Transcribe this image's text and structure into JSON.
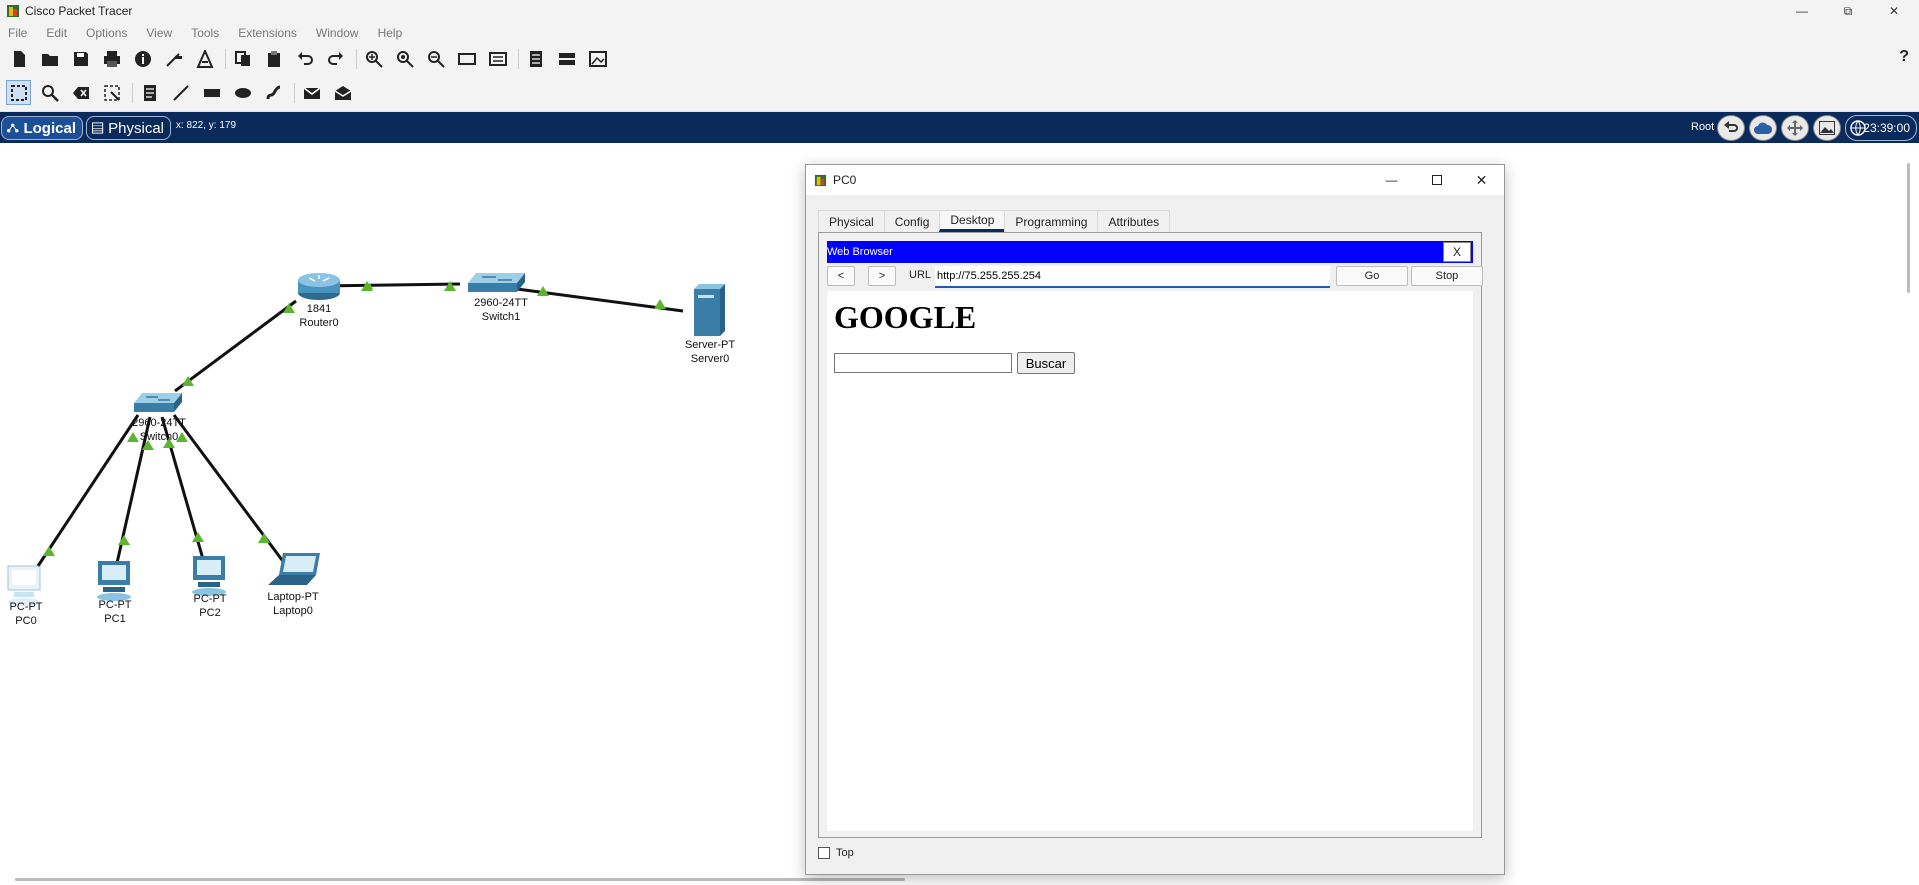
{
  "app": {
    "title": "Cisco Packet Tracer"
  },
  "menu": [
    "File",
    "Edit",
    "Options",
    "View",
    "Tools",
    "Extensions",
    "Window",
    "Help"
  ],
  "toolbar1_icons": [
    "new-icon",
    "open-icon",
    "save-icon",
    "print-icon",
    "info-icon",
    "network-wizard-icon",
    "activity-wizard-icon",
    "copy-icon",
    "paste-icon",
    "undo-icon",
    "redo-icon",
    "zoom-in-icon",
    "zoom-reset-icon",
    "zoom-out-icon",
    "drawing-palette-icon",
    "custom-device-icon",
    "notes-icon",
    "devices-icon",
    "view-image-icon"
  ],
  "toolbar2_icons": [
    "select-icon",
    "inspect-icon",
    "delete-icon",
    "resize-icon",
    "note-icon",
    "line-icon",
    "rectangle-icon",
    "ellipse-icon",
    "freeform-icon",
    "simple-pdu-icon",
    "complex-pdu-icon"
  ],
  "modebar": {
    "logical": "Logical",
    "physical": "Physical",
    "coords": "x: 822, y: 179",
    "root": "Root",
    "clock": "23:39:00"
  },
  "devices": [
    {
      "model": "1841",
      "name": "Router0"
    },
    {
      "model": "2960-24TT",
      "name": "Switch1"
    },
    {
      "model": "Server-PT",
      "name": "Server0"
    },
    {
      "model": "2960-24TT",
      "name": "Switch0"
    },
    {
      "model": "PC-PT",
      "name": "PC0"
    },
    {
      "model": "PC-PT",
      "name": "PC1"
    },
    {
      "model": "PC-PT",
      "name": "PC2"
    },
    {
      "model": "Laptop-PT",
      "name": "Laptop0"
    }
  ],
  "dialog": {
    "title": "PC0",
    "tabs": [
      "Physical",
      "Config",
      "Desktop",
      "Programming",
      "Attributes"
    ],
    "active_tab": "Desktop",
    "browser": {
      "title": "Web Browser",
      "close": "X",
      "back": "<",
      "forward": ">",
      "url_label": "URL",
      "url": "http://75.255.255.254",
      "go": "Go",
      "stop": "Stop",
      "heading": "GOOGLE",
      "search_value": "",
      "search_button": "Buscar"
    },
    "top_checkbox": "Top",
    "top_checked": false
  },
  "colors": {
    "modebar": "#0b2a5c",
    "browser_bar": "#0000ff",
    "link_up": "#5cb531",
    "device": "#3a7ea8"
  }
}
